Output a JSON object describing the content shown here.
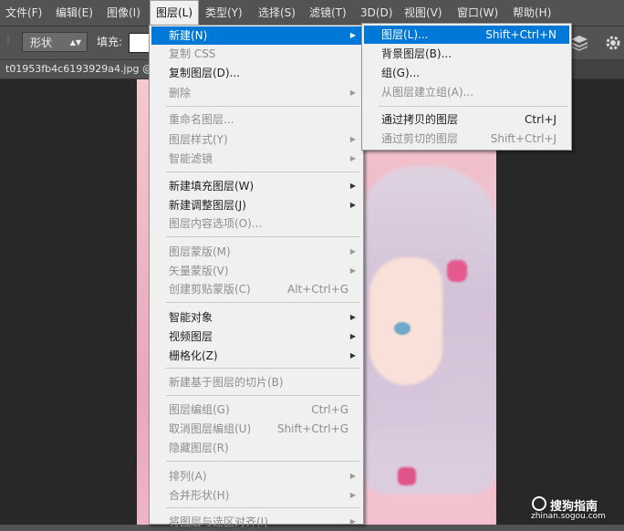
{
  "menubar": {
    "items": [
      "文件(F)",
      "编辑(E)",
      "图像(I)",
      "图层(L)",
      "类型(Y)",
      "选择(S)",
      "滤镜(T)",
      "3D(D)",
      "视图(V)",
      "窗口(W)",
      "帮助(H)"
    ],
    "active_index": 3
  },
  "options": {
    "shape_mode": "形状",
    "fill_label": "填充:",
    "fill_color": "#ffffff"
  },
  "document": {
    "tab_title": "t01953fb4c6193929a4.jpg @"
  },
  "layer_menu": {
    "items": [
      {
        "label": "新建(N)",
        "submenu": true,
        "highlighted": true
      },
      {
        "label": "复制 CSS",
        "disabled": true
      },
      {
        "label": "复制图层(D)..."
      },
      {
        "label": "删除",
        "submenu": true,
        "disabled": true
      },
      {
        "label": "重命名图层...",
        "disabled": true
      },
      {
        "label": "图层样式(Y)",
        "submenu": true,
        "disabled": true
      },
      {
        "label": "智能滤镜",
        "submenu": true,
        "disabled": true
      },
      {
        "label": "新建填充图层(W)",
        "submenu": true
      },
      {
        "label": "新建调整图层(J)",
        "submenu": true
      },
      {
        "label": "图层内容选项(O)...",
        "disabled": true
      },
      {
        "label": "图层蒙版(M)",
        "submenu": true,
        "disabled": true
      },
      {
        "label": "矢量蒙版(V)",
        "submenu": true,
        "disabled": true
      },
      {
        "label": "创建剪贴蒙版(C)",
        "shortcut": "Alt+Ctrl+G",
        "disabled": true
      },
      {
        "label": "智能对象",
        "submenu": true
      },
      {
        "label": "视频图层",
        "submenu": true
      },
      {
        "label": "栅格化(Z)",
        "submenu": true
      },
      {
        "label": "新建基于图层的切片(B)",
        "disabled": true
      },
      {
        "label": "图层编组(G)",
        "shortcut": "Ctrl+G",
        "disabled": true
      },
      {
        "label": "取消图层编组(U)",
        "shortcut": "Shift+Ctrl+G",
        "disabled": true
      },
      {
        "label": "隐藏图层(R)",
        "disabled": true
      },
      {
        "label": "排列(A)",
        "submenu": true,
        "disabled": true
      },
      {
        "label": "合并形状(H)",
        "submenu": true,
        "disabled": true
      },
      {
        "label": "将图层与选区对齐(I)",
        "submenu": true,
        "disabled": true
      }
    ]
  },
  "new_submenu": {
    "items": [
      {
        "label": "图层(L)...",
        "shortcut": "Shift+Ctrl+N",
        "highlighted": true
      },
      {
        "label": "背景图层(B)..."
      },
      {
        "label": "组(G)..."
      },
      {
        "label": "从图层建立组(A)...",
        "disabled": true
      },
      {
        "label": "通过拷贝的图层",
        "shortcut": "Ctrl+J"
      },
      {
        "label": "通过剪切的图层",
        "shortcut": "Shift+Ctrl+J",
        "disabled": true
      }
    ]
  },
  "watermark": {
    "brand": "搜狗指南",
    "url": "zhinan.sogou.com"
  }
}
